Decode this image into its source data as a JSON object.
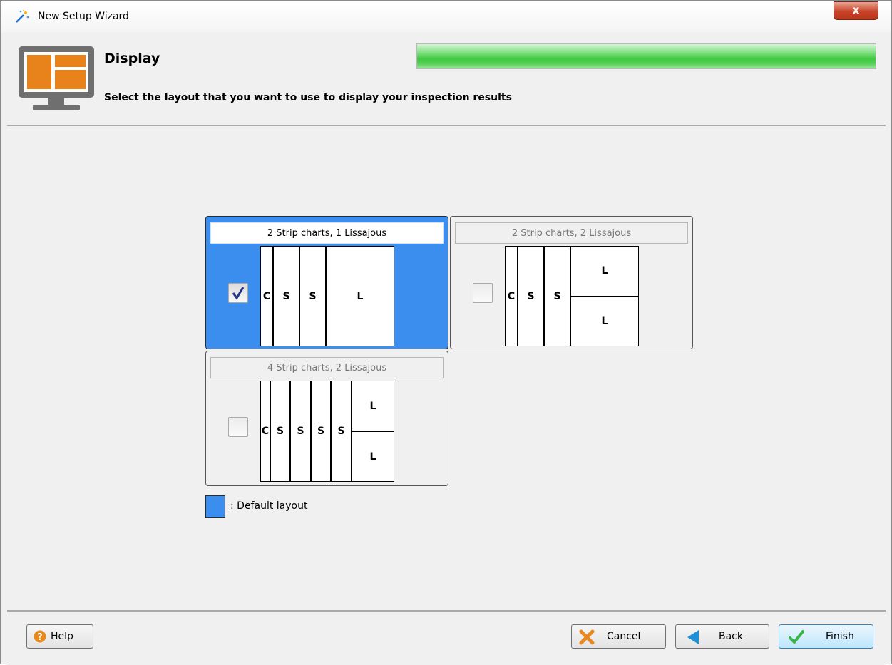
{
  "window": {
    "title": "New Setup Wizard",
    "close_label": "x"
  },
  "header": {
    "title": "Display",
    "description": "Select the layout that you want to use to display your inspection results",
    "progress_percent": 100
  },
  "layouts": [
    {
      "title": "2 Strip charts, 1 Lissajous",
      "checked": true,
      "is_default": true,
      "columns": [
        "C",
        "S",
        "S",
        "L"
      ]
    },
    {
      "title": "2 Strip charts, 2 Lissajous",
      "checked": false,
      "is_default": false,
      "columns": [
        "C",
        "S",
        "S"
      ],
      "lissajous": [
        "L",
        "L"
      ]
    },
    {
      "title": "4 Strip charts, 2 Lissajous",
      "checked": false,
      "is_default": false,
      "columns": [
        "C",
        "S",
        "S",
        "S",
        "S"
      ],
      "lissajous": [
        "L",
        "L"
      ]
    }
  ],
  "legend": {
    "label": ": Default layout",
    "color": "#3b8eed"
  },
  "footer": {
    "help_label": "Help",
    "cancel_label": "Cancel",
    "back_label": "Back",
    "finish_label": "Finish"
  },
  "colors": {
    "selected": "#3b8eed",
    "progress": "#41c941",
    "help_icon": "#e8891c",
    "cancel_icon": "#e88820",
    "back_icon": "#1f90d6",
    "finish_icon": "#3bb54a"
  }
}
